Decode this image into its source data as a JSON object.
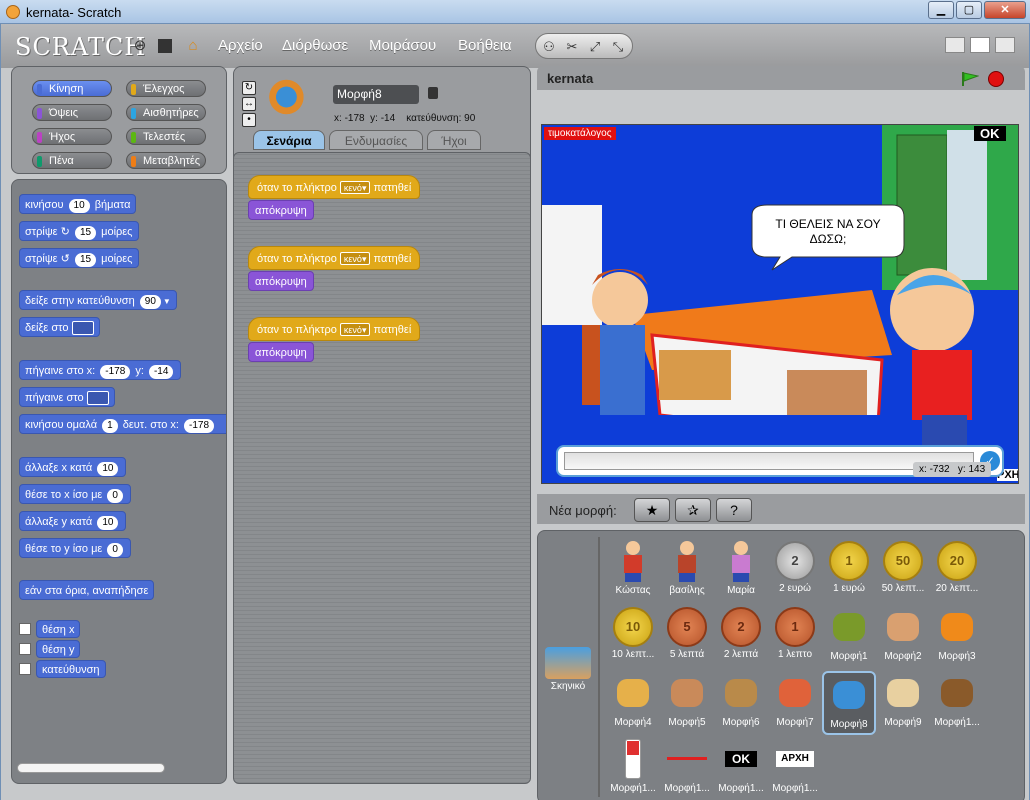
{
  "window": {
    "title": "kernata- Scratch"
  },
  "menu": {
    "file": "Αρχείο",
    "edit": "Διόρθωσε",
    "share": "Μοιράσου",
    "help": "Βοήθεια"
  },
  "categories": {
    "motion": "Κίνηση",
    "control": "Έλεγχος",
    "looks": "Όψεις",
    "sensing": "Αισθητήρες",
    "sound": "Ήχος",
    "operators": "Τελεστές",
    "pen": "Πένα",
    "variables": "Μεταβλητές"
  },
  "blocks": {
    "move": {
      "pre": "κινήσου",
      "val": "10",
      "post": "βήματα"
    },
    "turn_right": {
      "pre": "στρίψε",
      "val": "15",
      "post": "μοίρες"
    },
    "turn_left": {
      "pre": "στρίψε",
      "val": "15",
      "post": "μοίρες"
    },
    "point_dir": {
      "pre": "δείξε στην κατεύθυνση",
      "val": "90"
    },
    "point_to": {
      "pre": "δείξε στο"
    },
    "goto_xy": {
      "pre": "πήγαινε στο x:",
      "x": "-178",
      "mid": "y:",
      "y": "-14"
    },
    "goto": {
      "pre": "πήγαινε στο"
    },
    "glide": {
      "pre": "κινήσου ομαλά",
      "val": "1",
      "mid": "δευτ. στο x:",
      "x": "-178"
    },
    "change_x": {
      "pre": "άλλαξε x κατά",
      "val": "10"
    },
    "set_x": {
      "pre": "θέσε το x ίσο με",
      "val": "0"
    },
    "change_y": {
      "pre": "άλλαξε y κατά",
      "val": "10"
    },
    "set_y": {
      "pre": "θέσε το y ίσο με",
      "val": "0"
    },
    "bounce": "εάν στα όρια, αναπήδησε",
    "xpos": "θέση x",
    "ypos": "θέση y",
    "direction": "κατεύθυνση"
  },
  "sprite": {
    "name": "Μορφή8",
    "x_label": "x:",
    "x": "-178",
    "y_label": "y:",
    "y": "-14",
    "dir_label": "κατεύθυνση:",
    "dir": "90"
  },
  "tabs": {
    "scripts": "Σενάρια",
    "costumes": "Ενδυμασίες",
    "sounds": "Ήχοι"
  },
  "scripts": [
    {
      "hat_pre": "όταν το πλήκτρο",
      "key": "κενό",
      "hat_post": "πατηθεί",
      "action": "απόκρυψη"
    },
    {
      "hat_pre": "όταν το πλήκτρο",
      "key": "κενό",
      "hat_post": "πατηθεί",
      "action": "απόκρυψη"
    },
    {
      "hat_pre": "όταν το πλήκτρο",
      "key": "κενό",
      "hat_post": "πατηθεί",
      "action": "απόκρυψη"
    }
  ],
  "stage": {
    "project_name": "kernata",
    "price_label": "τιμοκατάλογος",
    "ok_label": "OK",
    "speech": "ΤΙ ΘΕΛΕΙΣ ΝΑ ΣΟΥ ΔΩΣΩ;",
    "arxi": "ΡΧΗ",
    "answer": ""
  },
  "mouse": {
    "x_label": "x:",
    "x": "-732",
    "y_label": "y:",
    "y": "143"
  },
  "new_sprite_label": "Νέα μορφή:",
  "stage_thumb_label": "Σκηνικό",
  "sprites": [
    {
      "label": "Κώστας",
      "kind": "boy",
      "color": "#d23b2a"
    },
    {
      "label": "βασίλης",
      "kind": "boy",
      "color": "#b9442a"
    },
    {
      "label": "Μαρία",
      "kind": "girl",
      "color": "#c97bd0"
    },
    {
      "label": "2 ευρώ",
      "kind": "silver",
      "text": "2"
    },
    {
      "label": "1 ευρώ",
      "kind": "gold",
      "text": "1"
    },
    {
      "label": "50 λεπτ...",
      "kind": "gold",
      "text": "50"
    },
    {
      "label": "20 λεπτ...",
      "kind": "gold",
      "text": "20"
    },
    {
      "label": "10 λεπτ...",
      "kind": "gold",
      "text": "10"
    },
    {
      "label": "5 λεπτά",
      "kind": "copper",
      "text": "5"
    },
    {
      "label": "2 λεπτά",
      "kind": "copper",
      "text": "2"
    },
    {
      "label": "1 λεπτο",
      "kind": "copper",
      "text": "1"
    },
    {
      "label": "Μορφή1",
      "kind": "food",
      "color": "#7a9a2a"
    },
    {
      "label": "Μορφή2",
      "kind": "food",
      "color": "#d9a070"
    },
    {
      "label": "Μορφή3",
      "kind": "food",
      "color": "#f08a1a"
    },
    {
      "label": "Μορφή4",
      "kind": "food",
      "color": "#e6b04a"
    },
    {
      "label": "Μορφή5",
      "kind": "food",
      "color": "#c98a5a"
    },
    {
      "label": "Μορφή6",
      "kind": "food",
      "color": "#b98a4a"
    },
    {
      "label": "Μορφή7",
      "kind": "food",
      "color": "#e0623a"
    },
    {
      "label": "Μορφή8",
      "kind": "food",
      "color": "#3a8fd6",
      "selected": true
    },
    {
      "label": "Μορφή9",
      "kind": "food",
      "color": "#e8d0a0"
    },
    {
      "label": "Μορφή1...",
      "kind": "food",
      "color": "#8a5a2a"
    },
    {
      "label": "Μορφή1...",
      "kind": "bottle",
      "color": "#e03030"
    },
    {
      "label": "Μορφή1...",
      "kind": "line",
      "color": "#e02020"
    },
    {
      "label": "Μορφή1...",
      "kind": "textblack",
      "text": "OK"
    },
    {
      "label": "Μορφή1...",
      "kind": "textwhite",
      "text": "ΑΡΧΗ"
    }
  ]
}
